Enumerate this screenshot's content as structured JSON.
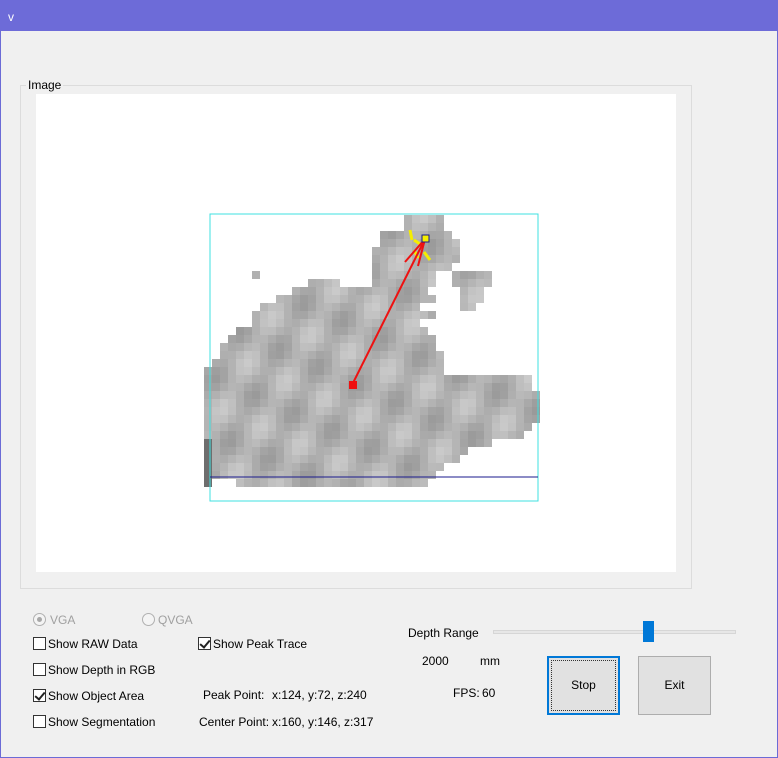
{
  "window": {
    "title": "v"
  },
  "image_group": {
    "label": "Image"
  },
  "resolution": {
    "vga_label": "VGA",
    "vga_selected": true,
    "qvga_label": "QVGA",
    "qvga_selected": false
  },
  "options": {
    "show_raw_data": {
      "label": "Show RAW Data",
      "checked": false
    },
    "show_depth_rgb": {
      "label": "Show Depth in RGB",
      "checked": false
    },
    "show_object_area": {
      "label": "Show Object Area",
      "checked": true
    },
    "show_segmentation": {
      "label": "Show Segmentation",
      "checked": false
    },
    "show_peak_trace": {
      "label": "Show Peak Trace",
      "checked": true
    }
  },
  "points": {
    "peak_label": "Peak Point:",
    "peak_value": "x:124, y:72, z:240",
    "center_label": "Center Point:",
    "center_value": "x:160, y:146, z:317"
  },
  "depth": {
    "label": "Depth Range",
    "value": "2000",
    "unit": "mm"
  },
  "fps": {
    "label": "FPS:",
    "value": "60"
  },
  "buttons": {
    "stop": "Stop",
    "exit": "Exit"
  },
  "colors": {
    "titlebar": "#6d6bd8",
    "bounding_box": "#3fe0e0",
    "trace": "#ee1111",
    "peak_marker": "#f5ee00",
    "baseline": "#1a1a8c",
    "slider_thumb": "#0078d7"
  }
}
